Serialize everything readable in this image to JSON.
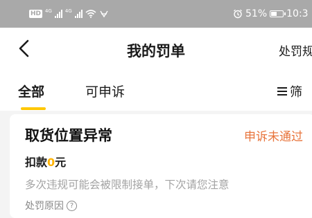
{
  "status_bar": {
    "hd_badge": "HD",
    "network_1": "4G",
    "network_2": "4G",
    "battery_percent": "51%",
    "battery_level": 0.51,
    "time": "10:3"
  },
  "nav": {
    "title": "我的罚单",
    "action_label": "处罚规"
  },
  "tabs": [
    {
      "label": "全部",
      "active": true
    },
    {
      "label": "可申诉",
      "active": false
    }
  ],
  "filter_label": "筛",
  "accent_color": "#ffc700",
  "status_color": "#e8743b",
  "penalty": {
    "title": "取货位置异常",
    "status": "申诉未通过",
    "deduction_prefix": "扣款",
    "deduction_amount": "0",
    "deduction_unit": "元",
    "warning": "多次违规可能会被限制接单，下次请您注意",
    "reason_link": "处罚原因"
  },
  "icons": [
    "back-chevron-icon",
    "menu-icon",
    "help-icon",
    "wifi-icon",
    "alarm-icon",
    "battery-icon"
  ]
}
